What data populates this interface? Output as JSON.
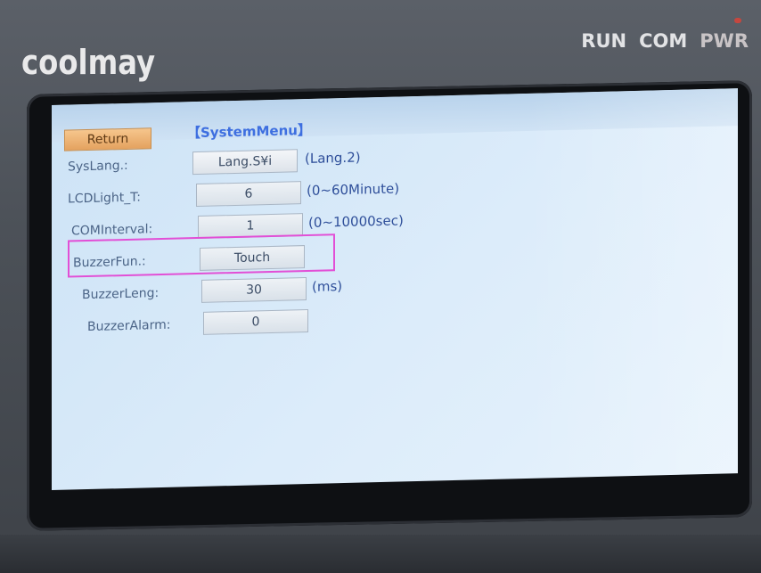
{
  "device": {
    "brand": "coolmay",
    "indicators": {
      "run": "RUN",
      "com": "COM",
      "pwr": "PWR"
    }
  },
  "screen": {
    "return_label": "Return",
    "menu_title": "【SystemMenu】",
    "rows": [
      {
        "label": "SysLang.:",
        "value": "Lang.S¥i",
        "unit": "(Lang.2)"
      },
      {
        "label": "LCDLight_T:",
        "value": "6",
        "unit": "(0~60Minute)"
      },
      {
        "label": "COMInterval:",
        "value": "1",
        "unit": "(0~10000sec)"
      },
      {
        "label": "BuzzerFun.:",
        "value": "Touch",
        "unit": ""
      },
      {
        "label": "BuzzerLeng:",
        "value": "30",
        "unit": "(ms)"
      },
      {
        "label": "BuzzerAlarm:",
        "value": "0",
        "unit": ""
      }
    ]
  },
  "colors": {
    "screen_bg": "#d6e8f8",
    "return_button": "#f2b775",
    "title_blue": "#3e6fe0",
    "highlight_magenta": "#e24fd6"
  }
}
